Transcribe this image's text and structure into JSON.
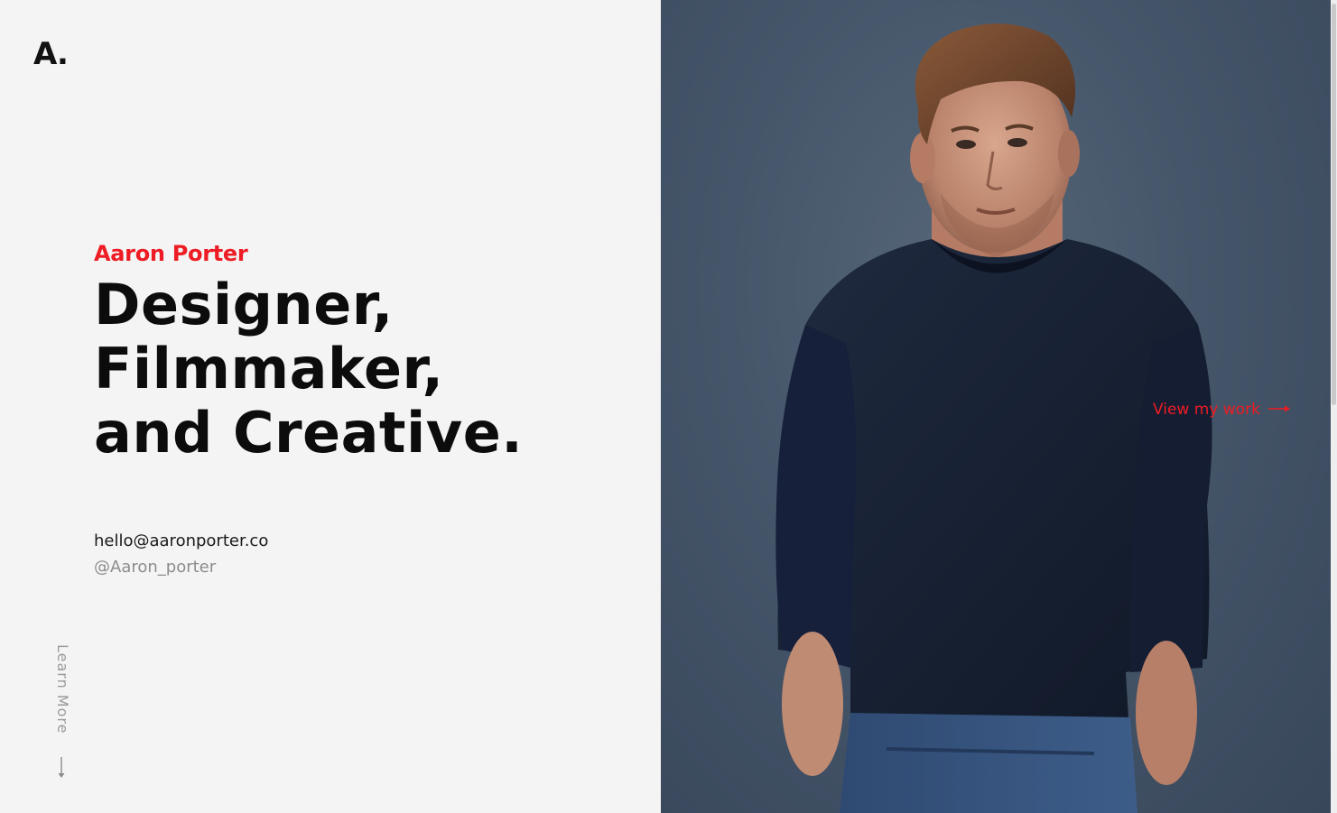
{
  "logo": {
    "text": "A."
  },
  "hero": {
    "name": "Aaron Porter",
    "headline": [
      "Designer,",
      "Filmmaker,",
      "and Creative."
    ]
  },
  "contact": {
    "email": "hello@aaronporter.co",
    "handle": "@Aaron_porter"
  },
  "learn_more": {
    "label": "Learn More"
  },
  "view_work": {
    "label": "View my work"
  },
  "photo": {
    "description_icon": "portrait-photo"
  },
  "colors": {
    "accent": "#ee1c24",
    "background": "#f4f4f4",
    "text": "#0c0c0c",
    "muted": "#8c8c8c",
    "photo_bg": "#46566a"
  }
}
